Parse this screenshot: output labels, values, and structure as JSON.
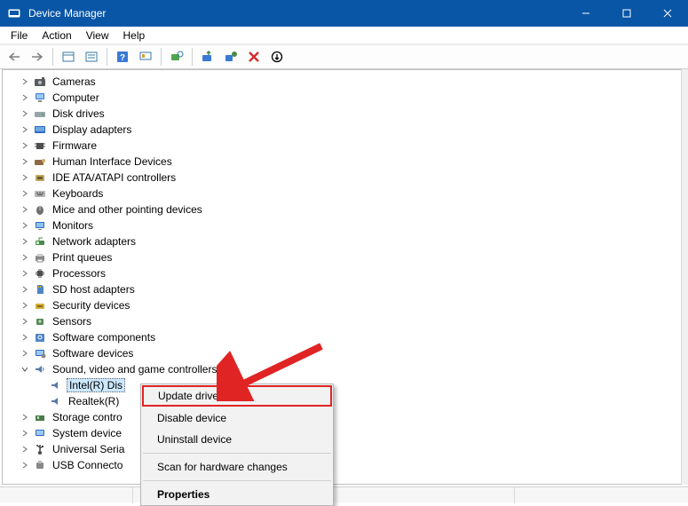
{
  "window": {
    "title": "Device Manager"
  },
  "menubar": {
    "items": [
      "File",
      "Action",
      "View",
      "Help"
    ]
  },
  "tree": {
    "categories": [
      {
        "label": "Cameras",
        "icon": "camera-icon"
      },
      {
        "label": "Computer",
        "icon": "computer-icon"
      },
      {
        "label": "Disk drives",
        "icon": "disk-icon"
      },
      {
        "label": "Display adapters",
        "icon": "display-adapter-icon"
      },
      {
        "label": "Firmware",
        "icon": "firmware-icon"
      },
      {
        "label": "Human Interface Devices",
        "icon": "hid-icon"
      },
      {
        "label": "IDE ATA/ATAPI controllers",
        "icon": "ide-icon"
      },
      {
        "label": "Keyboards",
        "icon": "keyboard-icon"
      },
      {
        "label": "Mice and other pointing devices",
        "icon": "mouse-icon"
      },
      {
        "label": "Monitors",
        "icon": "monitor-icon"
      },
      {
        "label": "Network adapters",
        "icon": "network-icon"
      },
      {
        "label": "Print queues",
        "icon": "printer-icon"
      },
      {
        "label": "Processors",
        "icon": "processor-icon"
      },
      {
        "label": "SD host adapters",
        "icon": "sd-icon"
      },
      {
        "label": "Security devices",
        "icon": "security-icon"
      },
      {
        "label": "Sensors",
        "icon": "sensor-icon"
      },
      {
        "label": "Software components",
        "icon": "software-component-icon"
      },
      {
        "label": "Software devices",
        "icon": "software-device-icon"
      },
      {
        "label": "Sound, video and game controllers",
        "icon": "sound-icon",
        "expanded": true,
        "children": [
          {
            "label": "Intel(R) Dis",
            "icon": "speaker-icon",
            "selected": true
          },
          {
            "label": "Realtek(R)",
            "icon": "speaker-icon"
          }
        ]
      },
      {
        "label": "Storage contro",
        "icon": "storage-icon"
      },
      {
        "label": "System device",
        "icon": "system-icon"
      },
      {
        "label": "Universal Seria",
        "icon": "usb-icon"
      },
      {
        "label": "USB Connecto",
        "icon": "usb-connector-icon"
      }
    ]
  },
  "context_menu": {
    "items": [
      {
        "label": "Update driver",
        "highlighted": true
      },
      {
        "label": "Disable device"
      },
      {
        "label": "Uninstall device"
      },
      {
        "sep": true
      },
      {
        "label": "Scan for hardware changes"
      },
      {
        "sep": true
      },
      {
        "label": "Properties",
        "bold": true
      }
    ]
  }
}
